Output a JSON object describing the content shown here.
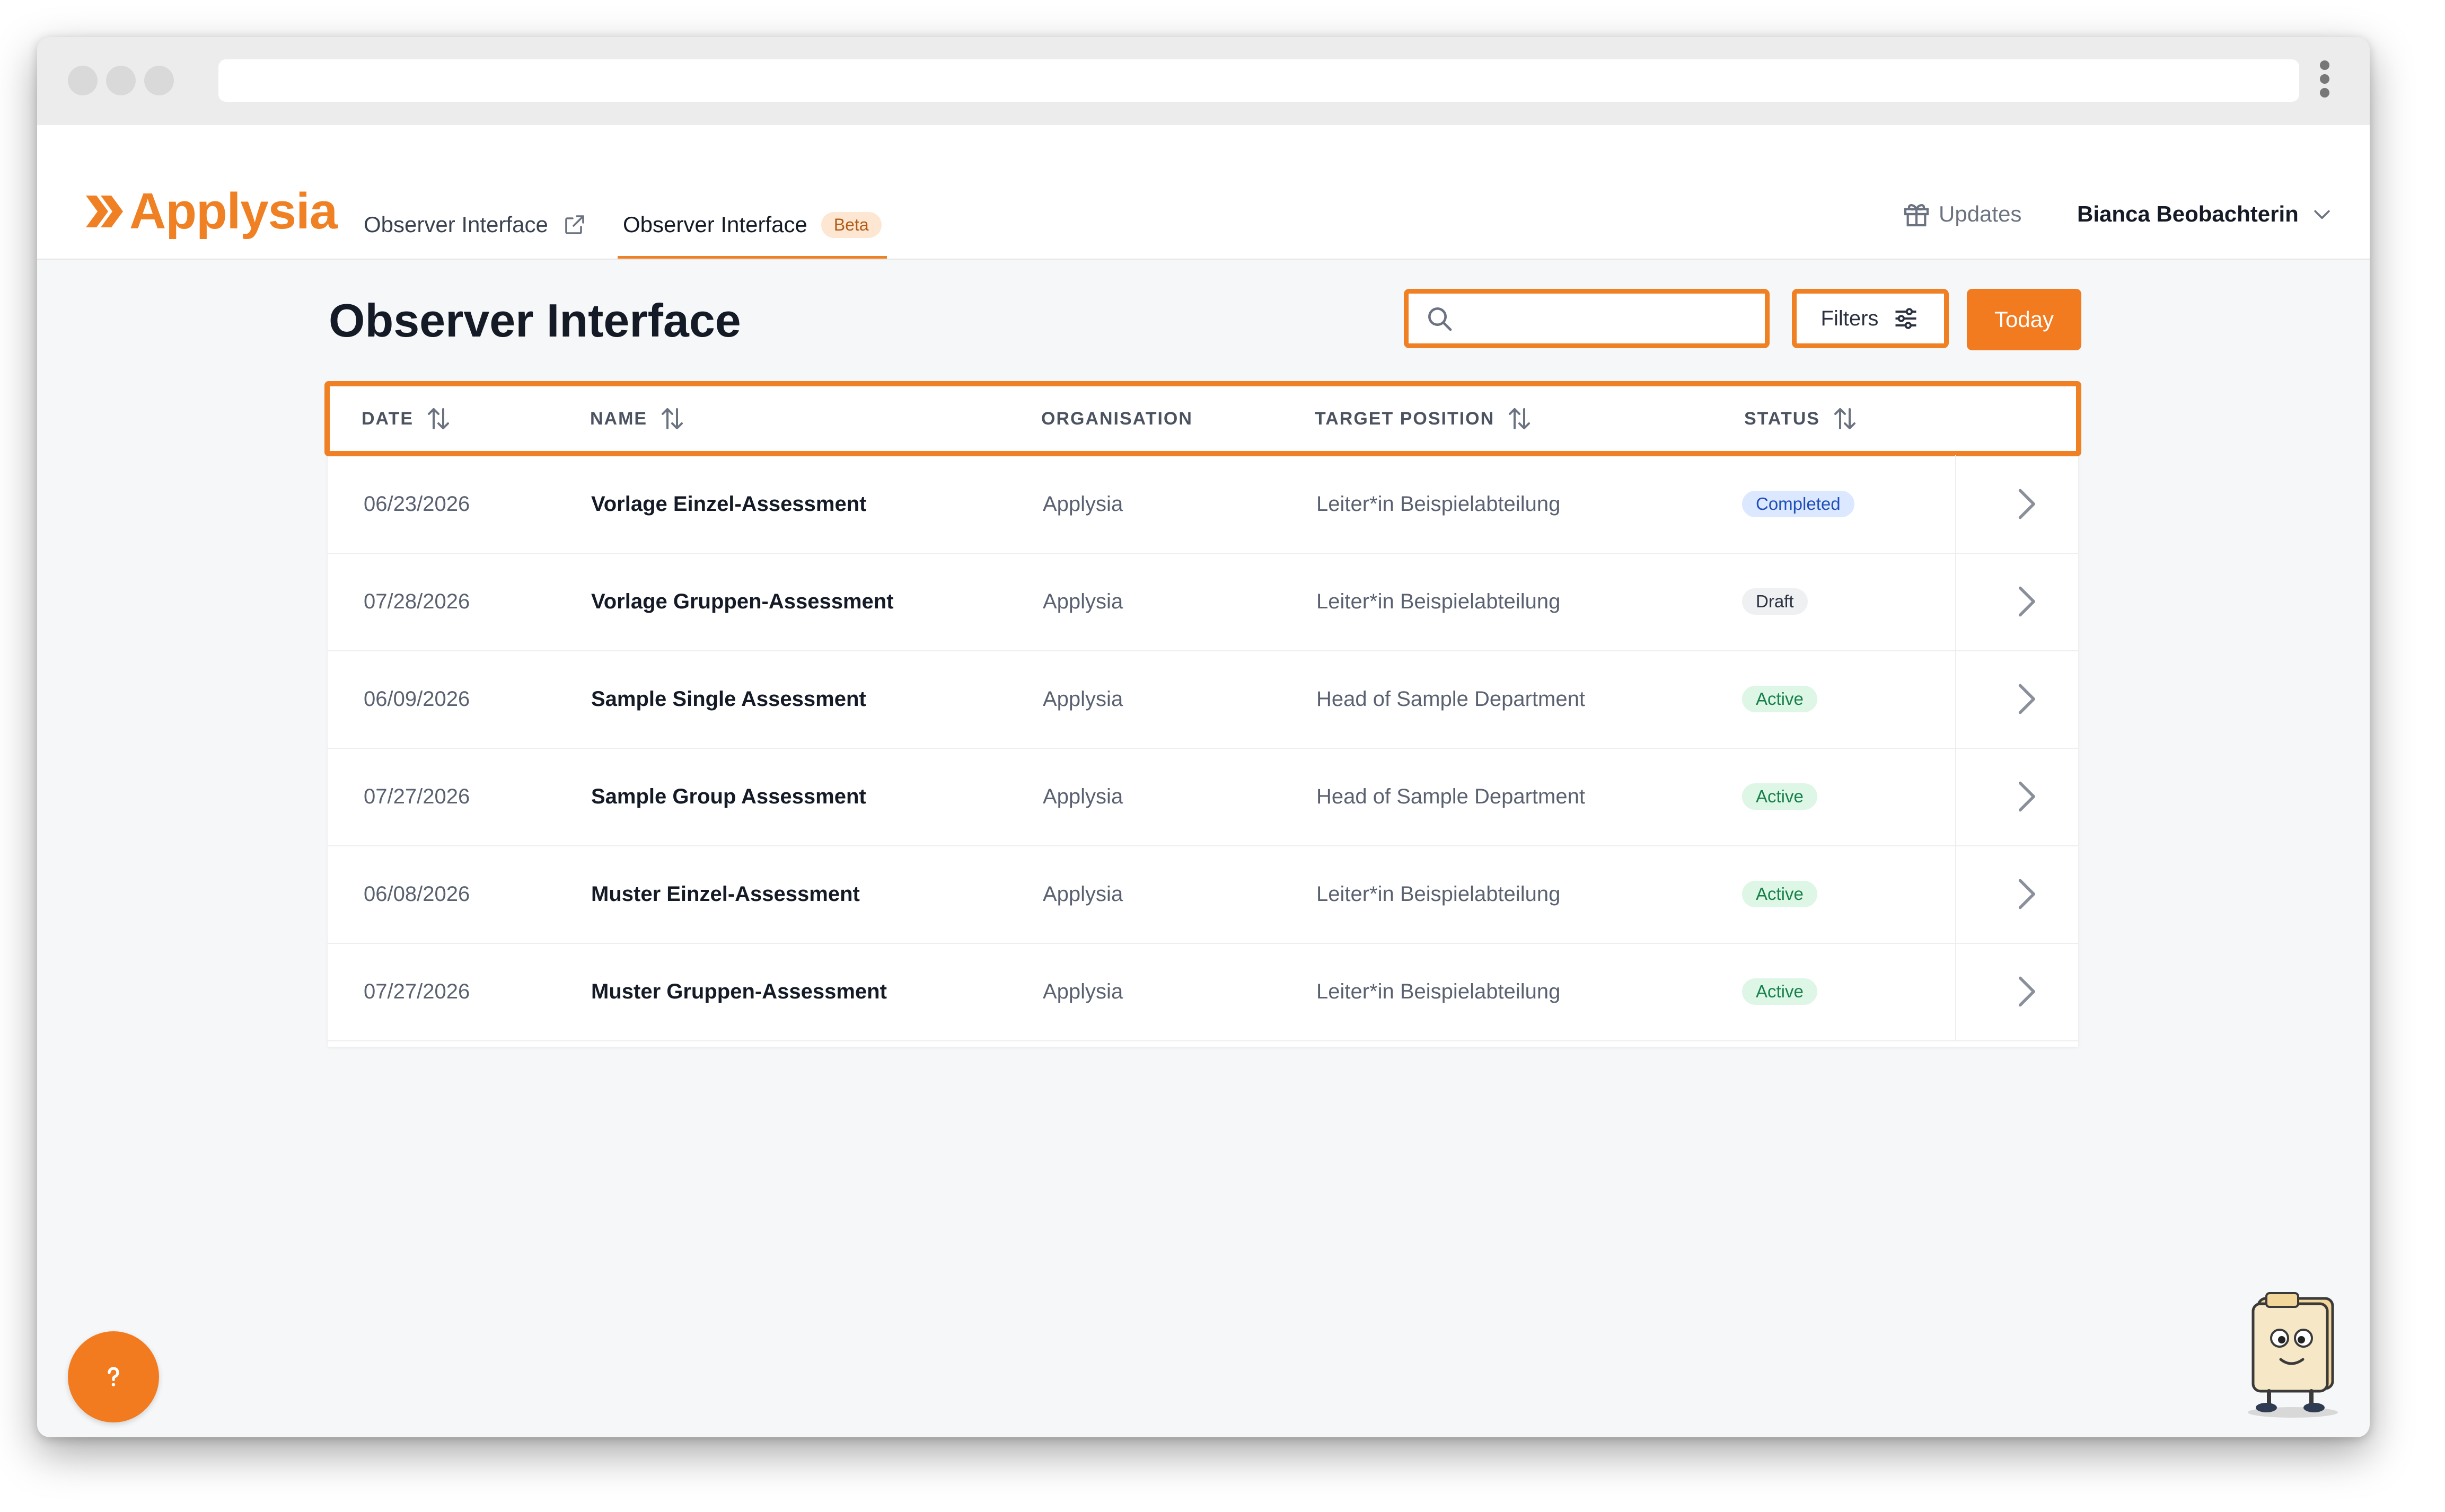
{
  "brand": {
    "name": "Applysia",
    "accent": "#f08024"
  },
  "nav": {
    "tabs": [
      {
        "label": "Observer Interface",
        "icon": "external-link-icon"
      },
      {
        "label": "Observer Interface",
        "badge": "Beta",
        "active": true
      }
    ],
    "updates_label": "Updates",
    "user_name": "Bianca Beobachterin"
  },
  "page": {
    "title": "Observer Interface"
  },
  "toolbar": {
    "search_placeholder": "",
    "filters_label": "Filters",
    "today_label": "Today"
  },
  "table": {
    "columns": [
      "DATE",
      "NAME",
      "ORGANISATION",
      "TARGET POSITION",
      "STATUS"
    ],
    "rows": [
      {
        "date": "06/23/2026",
        "name": "Vorlage Einzel-Assessment",
        "organisation": "Applysia",
        "target_position": "Leiter*in Beispielabteilung",
        "status": "Completed",
        "status_type": "completed"
      },
      {
        "date": "07/28/2026",
        "name": "Vorlage Gruppen-Assessment",
        "organisation": "Applysia",
        "target_position": "Leiter*in Beispielabteilung",
        "status": "Draft",
        "status_type": "draft"
      },
      {
        "date": "06/09/2026",
        "name": "Sample Single Assessment",
        "organisation": "Applysia",
        "target_position": "Head of Sample Department",
        "status": "Active",
        "status_type": "active"
      },
      {
        "date": "07/27/2026",
        "name": "Sample Group Assessment",
        "organisation": "Applysia",
        "target_position": "Head of Sample Department",
        "status": "Active",
        "status_type": "active"
      },
      {
        "date": "06/08/2026",
        "name": "Muster Einzel-Assessment",
        "organisation": "Applysia",
        "target_position": "Leiter*in Beispielabteilung",
        "status": "Active",
        "status_type": "active"
      },
      {
        "date": "07/27/2026",
        "name": "Muster Gruppen-Assessment",
        "organisation": "Applysia",
        "target_position": "Leiter*in Beispielabteilung",
        "status": "Active",
        "status_type": "active"
      }
    ]
  }
}
